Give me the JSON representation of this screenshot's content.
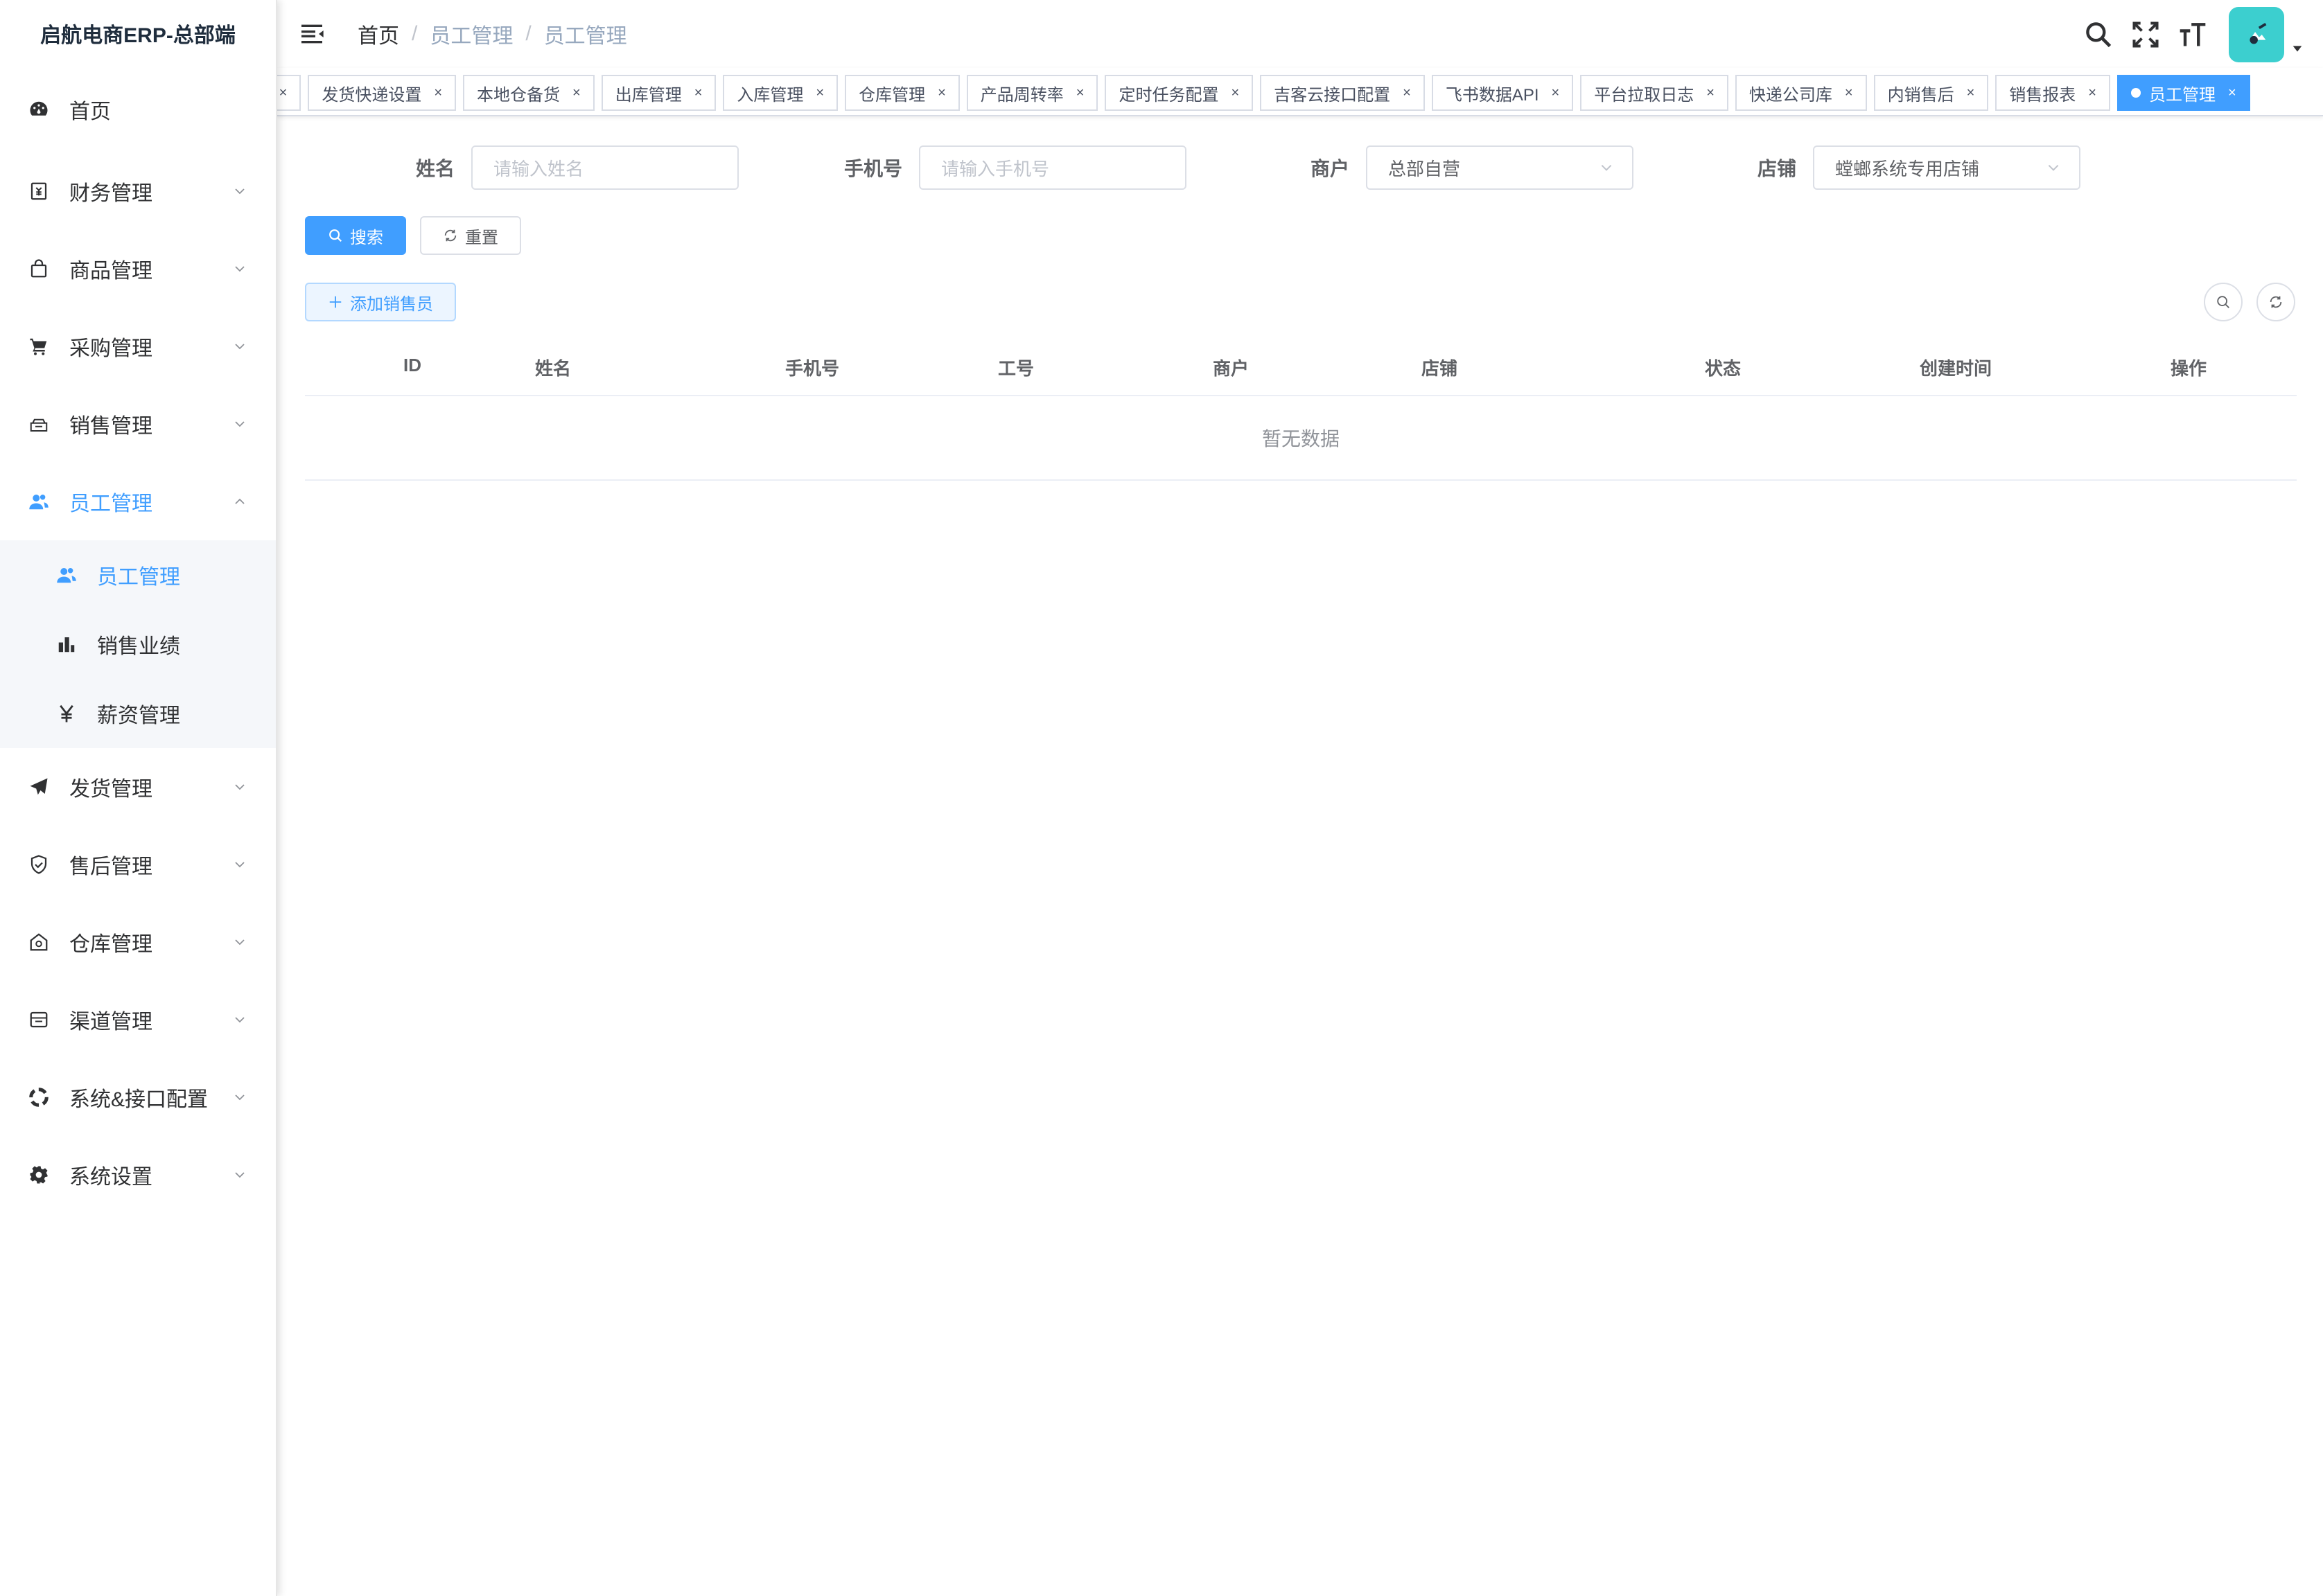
{
  "app": {
    "title": "启航电商ERP-总部端"
  },
  "sidebar": {
    "items": [
      {
        "label": "首页",
        "icon": "dashboard-icon"
      },
      {
        "label": "财务管理",
        "icon": "finance-icon"
      },
      {
        "label": "商品管理",
        "icon": "shopping-bag-icon"
      },
      {
        "label": "采购管理",
        "icon": "cart-icon"
      },
      {
        "label": "销售管理",
        "icon": "sales-icon"
      },
      {
        "label": "员工管理",
        "icon": "peoples-icon"
      },
      {
        "label": "发货管理",
        "icon": "send-icon"
      },
      {
        "label": "售后管理",
        "icon": "shield-icon"
      },
      {
        "label": "仓库管理",
        "icon": "warehouse-icon"
      },
      {
        "label": "渠道管理",
        "icon": "channel-icon"
      },
      {
        "label": "系统&接口配置",
        "icon": "api-icon"
      },
      {
        "label": "系统设置",
        "icon": "gear-icon"
      }
    ],
    "submenu": [
      {
        "label": "员工管理",
        "icon": "peoples-icon"
      },
      {
        "label": "销售业绩",
        "icon": "bar-chart-icon"
      },
      {
        "label": "薪资管理",
        "icon": "yen-icon"
      }
    ]
  },
  "breadcrumb": [
    "首页",
    "员工管理",
    "员工管理"
  ],
  "tags": [
    "发货快递设置",
    "本地仓备货",
    "出库管理",
    "入库管理",
    "仓库管理",
    "产品周转率",
    "定时任务配置",
    "吉客云接口配置",
    "飞书数据API",
    "平台拉取日志",
    "快递公司库",
    "内销售后",
    "销售报表",
    "员工管理"
  ],
  "tag_close": "×",
  "filters": {
    "name": {
      "label": "姓名",
      "placeholder": "请输入姓名"
    },
    "phone": {
      "label": "手机号",
      "placeholder": "请输入手机号"
    },
    "merchant": {
      "label": "商户",
      "value": "总部自营"
    },
    "shop": {
      "label": "店铺",
      "value": "螳螂系统专用店铺"
    }
  },
  "buttons": {
    "search": "搜索",
    "reset": "重置",
    "add": "添加销售员"
  },
  "table": {
    "columns": [
      "ID",
      "姓名",
      "手机号",
      "工号",
      "商户",
      "店铺",
      "状态",
      "创建时间",
      "操作"
    ],
    "empty_text": "暂无数据"
  },
  "colors": {
    "primary": "#409eff",
    "avatar_bg": "#3ccfcf"
  }
}
